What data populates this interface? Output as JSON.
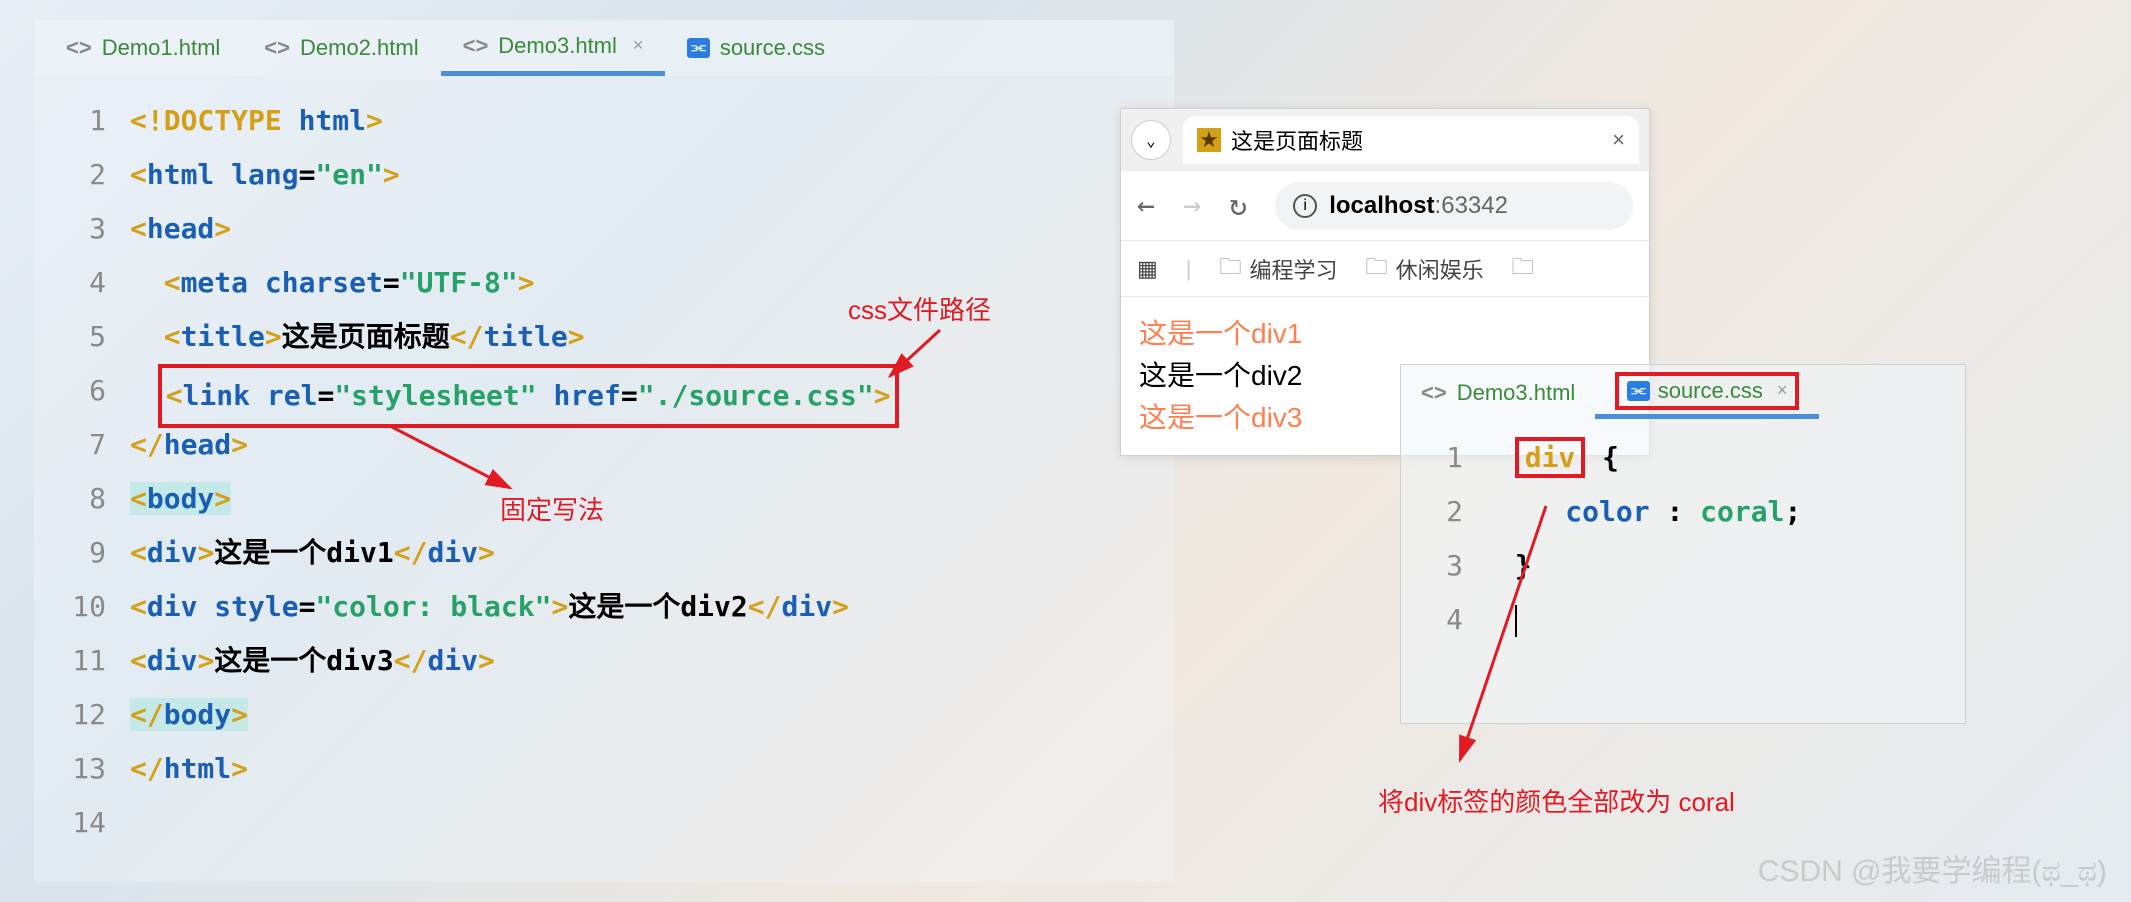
{
  "ide": {
    "tabs": [
      {
        "icon": "<>",
        "label": "Demo1.html"
      },
      {
        "icon": "<>",
        "label": "Demo2.html"
      },
      {
        "icon": "<>",
        "label": "Demo3.html",
        "active": true
      },
      {
        "icon": "css",
        "label": "source.css"
      }
    ],
    "lines": [
      "1",
      "2",
      "3",
      "4",
      "5",
      "6",
      "7",
      "8",
      "9",
      "10",
      "11",
      "12",
      "13",
      "14"
    ],
    "code": {
      "l1": {
        "doctype": "<!DOCTYPE ",
        "html": "html",
        "close": ">"
      },
      "l2": {
        "open": "<",
        "tag": "html ",
        "attr": "lang",
        "eq": "=",
        "val": "\"en\"",
        "close": ">"
      },
      "l3": {
        "open": "<",
        "tag": "head",
        "close": ">"
      },
      "l4": {
        "open": "<",
        "tag": "meta ",
        "attr": "charset",
        "eq": "=",
        "val": "\"UTF-8\"",
        "close": ">"
      },
      "l5": {
        "open1": "<",
        "tag1": "title",
        "close1": ">",
        "text": "这是页面标题",
        "open2": "</",
        "tag2": "title",
        "close2": ">"
      },
      "l6": {
        "open": "<",
        "tag": "link ",
        "attr1": "rel",
        "eq1": "=",
        "val1": "\"stylesheet\" ",
        "attr2": "href",
        "eq2": "=",
        "val2": "\"./source.css\"",
        "close": ">"
      },
      "l7": {
        "open": "</",
        "tag": "head",
        "close": ">"
      },
      "l8": {
        "open": "<",
        "tag": "body",
        "close": ">"
      },
      "l9": {
        "open1": "<",
        "tag1": "div",
        "close1": ">",
        "text": "这是一个div1",
        "open2": "</",
        "tag2": "div",
        "close2": ">"
      },
      "l10": {
        "open1": "<",
        "tag1": "div ",
        "attr": "style",
        "eq": "=",
        "val": "\"color: black\"",
        "close1": ">",
        "text": "这是一个div2",
        "open2": "</",
        "tag2": "div",
        "close2": ">"
      },
      "l11": {
        "open1": "<",
        "tag1": "div",
        "close1": ">",
        "text": "这是一个div3",
        "open2": "</",
        "tag2": "div",
        "close2": ">"
      },
      "l12": {
        "open": "</",
        "tag": "body",
        "close": ">"
      },
      "l13": {
        "open": "</",
        "tag": "html",
        "close": ">"
      }
    }
  },
  "annotations": {
    "css_path": "css文件路径",
    "fixed_syntax": "固定写法",
    "change_color": "将div标签的颜色全部改为 coral"
  },
  "browser": {
    "tab_title": "这是页面标题",
    "url_host": "localhost",
    "url_port": ":63342",
    "bookmarks": {
      "study": "编程学习",
      "entertainment": "休闲娱乐"
    },
    "content": {
      "d1": "这是一个div1",
      "d2": "这是一个div2",
      "d3": "这是一个div3"
    }
  },
  "css_editor": {
    "tabs": [
      {
        "icon": "<>",
        "label": "Demo3.html"
      },
      {
        "icon": "css",
        "label": "source.css",
        "active": true
      }
    ],
    "lines": [
      "1",
      "2",
      "3",
      "4"
    ],
    "code": {
      "selector": "div",
      "brace_open": " {",
      "prop": "color",
      "colon": " : ",
      "val": "coral",
      "semi": ";",
      "brace_close": "}"
    }
  },
  "watermark": "CSDN @我要学编程(ಥ_ಥ)"
}
